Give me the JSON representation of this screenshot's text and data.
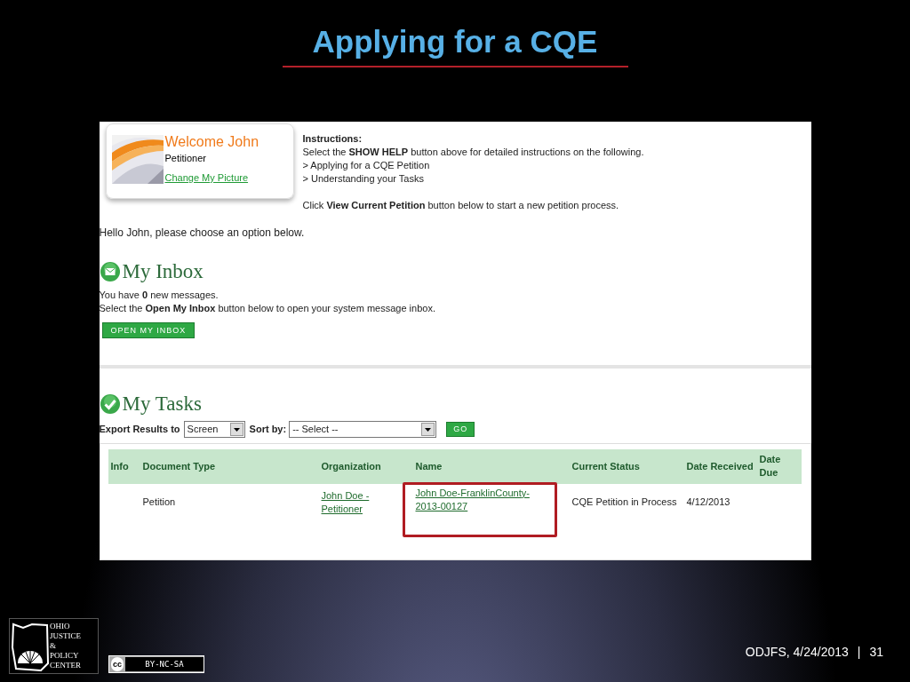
{
  "slide": {
    "title": "Applying for a CQE",
    "footer": "ODJFS, 4/24/2013",
    "separator": "|",
    "page_number": "31"
  },
  "logo": {
    "lines": [
      "OHIO",
      "JUSTICE",
      "&",
      "POLICY",
      "CENTER"
    ]
  },
  "license_badge": {
    "symbol": "cc",
    "label": "BY-NC-SA"
  },
  "profile": {
    "greeting": "Welcome John",
    "role": "Petitioner",
    "link": "Change My Picture"
  },
  "instructions": {
    "heading": "Instructions:",
    "lines": [
      "Select the **SHOW HELP** button above for detailed instructions on the following.",
      "> Applying for a CQE Petition",
      "> Understanding your Tasks"
    ],
    "note": "Click **View Current Petition** button below to start a new petition process."
  },
  "hello": "Hello John, please choose an option below.",
  "inbox": {
    "title": "My Inbox",
    "lines": [
      "You have **0** new messages.",
      "Select the **Open My Inbox** button below to open your system message inbox."
    ],
    "button": "OPEN MY INBOX"
  },
  "tasks": {
    "title": "My Tasks",
    "export_label": "Export Results to",
    "export_value": "Screen",
    "sort_label": "Sort by:",
    "sort_value": "-- Select --",
    "go_button": "GO",
    "table": {
      "columns": [
        "Info",
        "Document Type",
        "Organization",
        "Name",
        "Current Status",
        "Date Received",
        "Date Due"
      ],
      "rows": [
        {
          "cells": [
            {
              "kind": "empty",
              "highlighted": false
            },
            {
              "kind": "text",
              "text": "Petition",
              "highlighted": false
            },
            {
              "kind": "link",
              "text": "John Doe - Petitioner",
              "highlighted": false
            },
            {
              "kind": "link",
              "text": "John Doe-FranklinCounty-2013-00127",
              "highlighted": true
            },
            {
              "kind": "text",
              "text": "CQE Petition in Process",
              "highlighted": false
            },
            {
              "kind": "text",
              "text": "4/12/2013",
              "highlighted": false
            }
          ]
        }
      ]
    }
  }
}
